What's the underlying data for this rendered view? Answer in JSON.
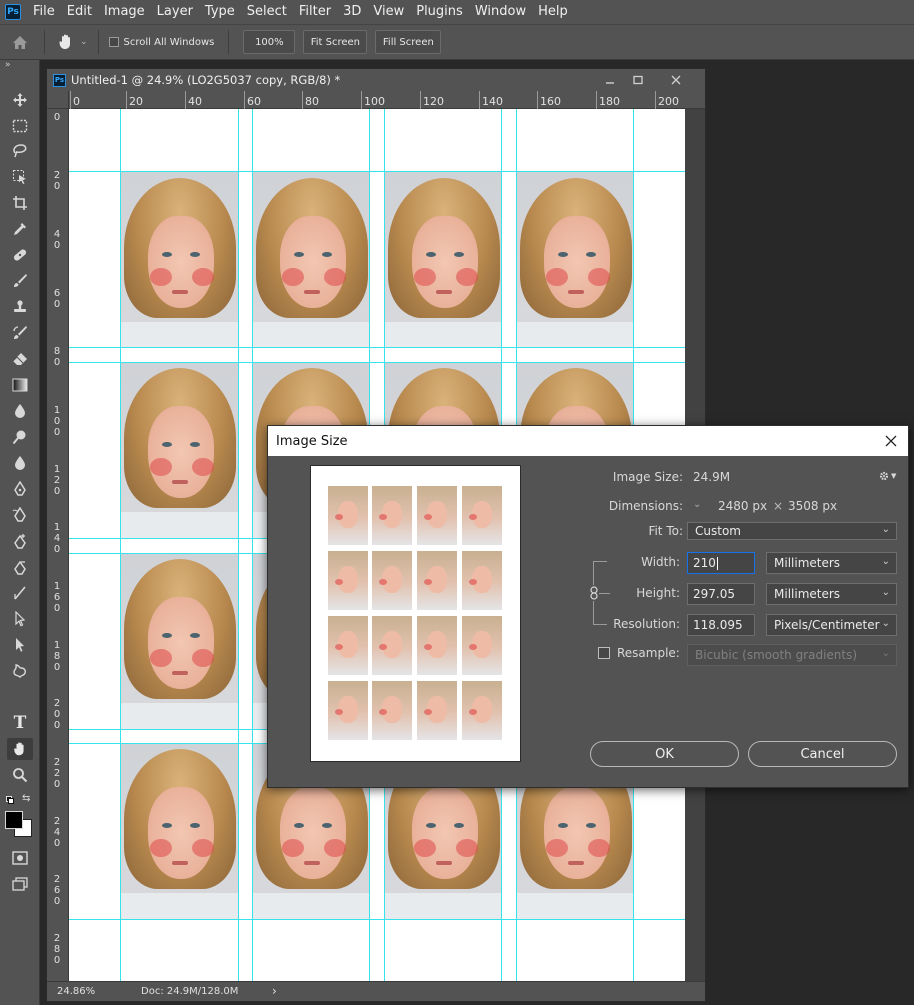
{
  "menu": [
    "File",
    "Edit",
    "Image",
    "Layer",
    "Type",
    "Select",
    "Filter",
    "3D",
    "View",
    "Plugins",
    "Window",
    "Help"
  ],
  "app_logo": "Ps",
  "options_bar": {
    "scroll_all_windows": "Scroll All Windows",
    "zoom": "100%",
    "fit_screen": "Fit Screen",
    "fill_screen": "Fill Screen"
  },
  "document": {
    "logo": "Ps",
    "title": "Untitled-1 @ 24.9% (LO2G5037 copy, RGB/8) *",
    "ruler_h": [
      "0",
      "20",
      "40",
      "60",
      "80",
      "100",
      "120",
      "140",
      "160",
      "180",
      "200"
    ],
    "ruler_v": [
      "0",
      "2\n0",
      "4\n0",
      "6\n0",
      "8\n0",
      "1\n0\n0",
      "1\n2\n0",
      "1\n4\n0",
      "1\n6\n0",
      "1\n8\n0",
      "2\n0\n0",
      "2\n2\n0",
      "2\n4\n0",
      "2\n6\n0",
      "2\n8\n0"
    ],
    "status_zoom": "24.86%",
    "status_doc": "Doc: 24.9M/128.0M",
    "status_arrow": "›"
  },
  "dialog": {
    "title": "Image Size",
    "image_size_label": "Image Size:",
    "image_size_value": "24.9M",
    "dimensions_label": "Dimensions:",
    "dim_width": "2480 px",
    "dim_times": "×",
    "dim_height": "3508 px",
    "fit_to_label": "Fit To:",
    "fit_to_value": "Custom",
    "width_label": "Width:",
    "width_value": "210",
    "width_unit": "Millimeters",
    "height_label": "Height:",
    "height_value": "297.05",
    "height_unit": "Millimeters",
    "resolution_label": "Resolution:",
    "resolution_value": "118.095",
    "resolution_unit": "Pixels/Centimeter",
    "resample_label": "Resample:",
    "resample_checked": false,
    "resample_value": "Bicubic (smooth gradients)",
    "ok": "OK",
    "cancel": "Cancel"
  },
  "colors": {
    "guide": "#35e4ea",
    "panel": "#535353",
    "background": "#282828",
    "ps_blue": "#31a8ff"
  },
  "icons": [
    "home-icon",
    "hand-tool-icon",
    "move-tool-icon",
    "marquee-tool-icon",
    "lasso-tool-icon",
    "object-select-tool-icon",
    "crop-tool-icon",
    "eyedropper-tool-icon",
    "healing-brush-tool-icon",
    "brush-tool-icon",
    "clone-stamp-tool-icon",
    "history-brush-tool-icon",
    "eraser-tool-icon",
    "gradient-tool-icon",
    "blur-tool-icon",
    "dodge-tool-icon",
    "pen-tool-icon",
    "path-select-tool-icon",
    "direct-select-tool-icon",
    "custom-shape-tool-icon",
    "type-tool-icon",
    "zoom-tool-icon",
    "gear-icon",
    "link-chain-icon",
    "close-icon"
  ]
}
